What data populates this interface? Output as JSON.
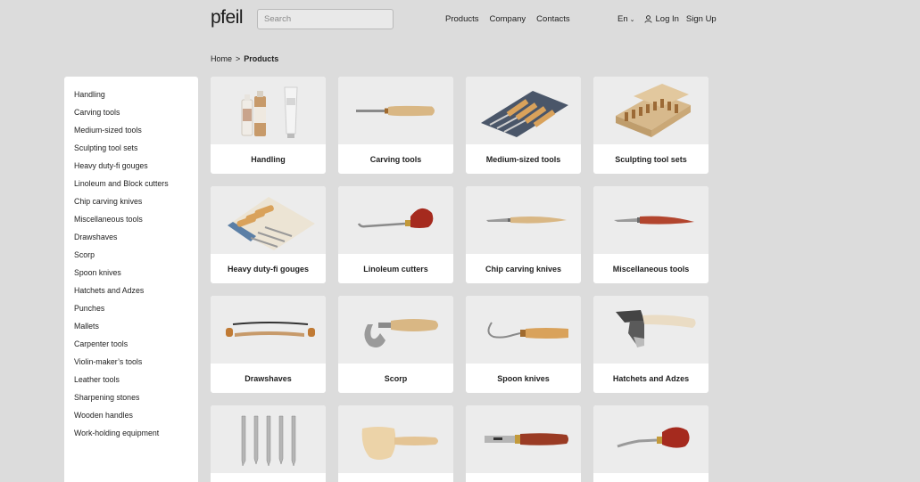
{
  "header": {
    "logo": "pfeil",
    "search_placeholder": "Search",
    "nav": [
      "Products",
      "Company",
      "Contacts"
    ],
    "lang": "En",
    "login": "Log In",
    "signup": "Sign Up"
  },
  "breadcrumb": {
    "home": "Home",
    "sep": ">",
    "current": "Products"
  },
  "sidebar": {
    "items": [
      "Handling",
      "Carving tools",
      "Medium-sized tools",
      "Sculpting tool sets",
      "Heavy duty-fi gouges",
      "Linoleum and Block cutters",
      "Chip carving knives",
      "Miscellaneous tools",
      "Drawshaves",
      "Scorp",
      "Spoon knives",
      "Hatchets and Adzes",
      "Punches",
      "Mallets",
      "Carpenter tools",
      "Violin-maker’s tools",
      "Leather tools",
      "Sharpening stones",
      "Wooden handles",
      "Work-holding equipment"
    ]
  },
  "products": [
    {
      "label": "Handling",
      "icon": "bottles-icon"
    },
    {
      "label": "Carving tools",
      "icon": "chisel-icon"
    },
    {
      "label": "Medium-sized tools",
      "icon": "tool-roll-icon"
    },
    {
      "label": "Sculpting tool sets",
      "icon": "tool-box-icon"
    },
    {
      "label": "Heavy duty-fi gouges",
      "icon": "gouge-roll-icon"
    },
    {
      "label": "Linoleum cutters",
      "icon": "linoleum-cutter-icon"
    },
    {
      "label": "Chip carving knives",
      "icon": "chip-knife-icon"
    },
    {
      "label": "Miscellaneous tools",
      "icon": "misc-knife-icon"
    },
    {
      "label": "Drawshaves",
      "icon": "drawshave-icon"
    },
    {
      "label": "Scorp",
      "icon": "scorp-icon"
    },
    {
      "label": "Spoon knives",
      "icon": "spoon-knife-icon"
    },
    {
      "label": "Hatchets and Adzes",
      "icon": "adze-icon"
    },
    {
      "label": "",
      "icon": "punches-icon"
    },
    {
      "label": "",
      "icon": "mallet-icon"
    },
    {
      "label": "",
      "icon": "carpenter-chisel-icon"
    },
    {
      "label": "",
      "icon": "violin-knife-icon"
    }
  ]
}
